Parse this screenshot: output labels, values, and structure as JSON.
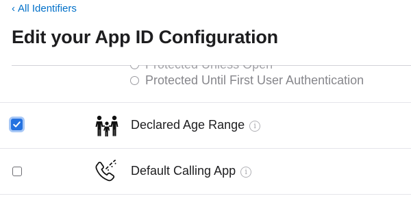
{
  "breadcrumb": {
    "chevron": "‹",
    "label": "All Identifiers"
  },
  "page": {
    "title": "Edit your App ID Configuration"
  },
  "radio_options": [
    {
      "label": "Protected Unless Open",
      "selected": false
    },
    {
      "label": "Protected Until First User Authentication",
      "selected": false
    }
  ],
  "capabilities": [
    {
      "label": "Declared Age Range",
      "checked": true,
      "icon": "family-icon",
      "info": "i"
    },
    {
      "label": "Default Calling App",
      "checked": false,
      "icon": "phone-calling-icon",
      "info": "i"
    }
  ],
  "colors": {
    "link": "#0070c9",
    "checkbox_accent": "#2572e0",
    "title": "#1d1d1f",
    "muted": "#86868b"
  }
}
